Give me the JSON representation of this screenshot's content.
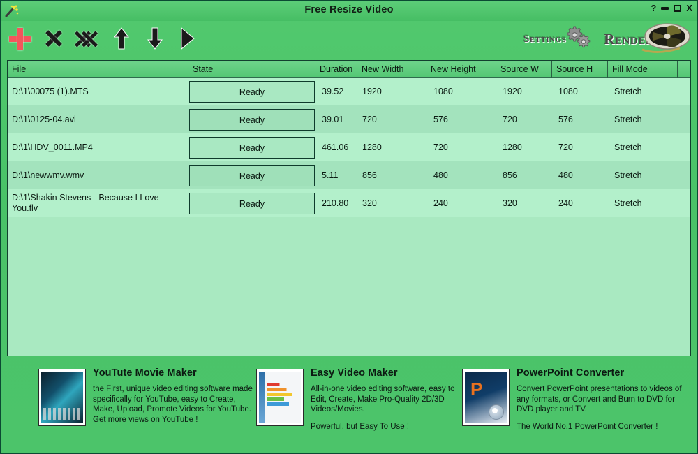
{
  "window": {
    "title": "Free Resize Video",
    "app_icon": "magic-wand-icon",
    "controls": {
      "help": "?",
      "minimize": "minimize",
      "maximize": "maximize",
      "close": "X"
    }
  },
  "toolbar": {
    "buttons": [
      {
        "name": "add-file-button",
        "icon": "plus-icon",
        "label": ""
      },
      {
        "name": "remove-file-button",
        "icon": "x-icon",
        "label": ""
      },
      {
        "name": "remove-all-button",
        "icon": "double-x-icon",
        "label": ""
      },
      {
        "name": "move-up-button",
        "icon": "arrow-up-icon",
        "label": ""
      },
      {
        "name": "move-down-button",
        "icon": "arrow-down-icon",
        "label": ""
      },
      {
        "name": "play-button",
        "icon": "play-icon",
        "label": ""
      }
    ],
    "settings_label": "Settings",
    "render_label": "Render",
    "settings_icon": "gear-icon",
    "render_icon": "film-reel-icon"
  },
  "table": {
    "columns": [
      {
        "key": "file",
        "label": "File"
      },
      {
        "key": "state",
        "label": "State"
      },
      {
        "key": "duration",
        "label": "Duration"
      },
      {
        "key": "new_width",
        "label": "New Width"
      },
      {
        "key": "new_height",
        "label": "New Height"
      },
      {
        "key": "source_w",
        "label": "Source W"
      },
      {
        "key": "source_h",
        "label": "Source H"
      },
      {
        "key": "fill_mode",
        "label": "Fill Mode"
      },
      {
        "key": "extra",
        "label": ""
      }
    ],
    "rows": [
      {
        "file": "D:\\1\\00075 (1).MTS",
        "state": "Ready",
        "duration": "39.52",
        "new_width": "1920",
        "new_height": "1080",
        "source_w": "1920",
        "source_h": "1080",
        "fill_mode": "Stretch"
      },
      {
        "file": "D:\\1\\0125-04.avi",
        "state": "Ready",
        "duration": "39.01",
        "new_width": "720",
        "new_height": "576",
        "source_w": "720",
        "source_h": "576",
        "fill_mode": "Stretch"
      },
      {
        "file": "D:\\1\\HDV_0011.MP4",
        "state": "Ready",
        "duration": "461.06",
        "new_width": "1280",
        "new_height": "720",
        "source_w": "1280",
        "source_h": "720",
        "fill_mode": "Stretch"
      },
      {
        "file": "D:\\1\\newwmv.wmv",
        "state": "Ready",
        "duration": "5.11",
        "new_width": "856",
        "new_height": "480",
        "source_w": "856",
        "source_h": "480",
        "fill_mode": "Stretch"
      },
      {
        "file": "D:\\1\\Shakin Stevens - Because I Love You.flv",
        "state": "Ready",
        "duration": "210.80",
        "new_width": "320",
        "new_height": "240",
        "source_w": "320",
        "source_h": "240",
        "fill_mode": "Stretch"
      }
    ]
  },
  "ads": [
    {
      "title": "YouTute Movie Maker",
      "body": "the First, unique video editing software made specifically for YouTube, easy to Create, Make, Upload, Promote Videos for YouTube.\nGet more views on YouTube !",
      "tagline": "",
      "thumb": "software-box-youtube-movie-maker"
    },
    {
      "title": "Easy Video Maker",
      "body": "All-in-one video editing software, easy to Edit, Create, Make Pro-Quality 2D/3D Videos/Movies.",
      "tagline": "Powerful, but Easy To Use !",
      "thumb": "software-box-easy-video-maker"
    },
    {
      "title": "PowerPoint Converter",
      "body": "Convert PowerPoint presentations to videos of any formats, or Convert and Burn to DVD for DVD player and TV.",
      "tagline": "The World No.1 PowerPoint Converter !",
      "thumb": "software-box-powerpoint-converter"
    }
  ],
  "colors": {
    "window_bg": "#4cc46a",
    "titlebar": "#52c96e",
    "panel_border": "#123f2e",
    "row_odd": "#b3f0cb",
    "row_even": "#a3e3bd",
    "header_bg": "#6ed48a",
    "plus_icon": "#f4565c",
    "text": "#0b1a12"
  }
}
